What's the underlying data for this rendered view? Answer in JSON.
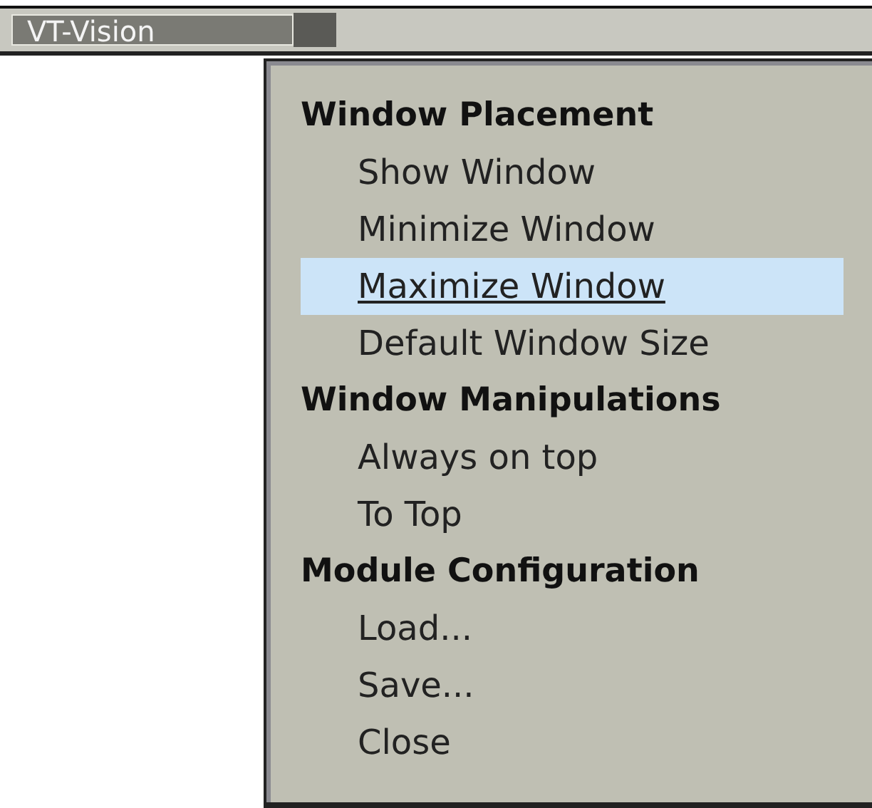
{
  "taskbar": {
    "tab": {
      "label": "VT-Vision"
    }
  },
  "menu": {
    "sections": [
      {
        "heading": "Window Placement",
        "items": [
          {
            "label": "Show Window",
            "selected": false
          },
          {
            "label": "Minimize Window",
            "selected": false
          },
          {
            "label": "Maximize Window",
            "selected": true
          },
          {
            "label": "Default Window Size",
            "selected": false
          }
        ]
      },
      {
        "heading": "Window Manipulations",
        "items": [
          {
            "label": "Always on top",
            "selected": false
          },
          {
            "label": "To Top",
            "selected": false
          }
        ]
      },
      {
        "heading": "Module Configuration",
        "items": [
          {
            "label": "Load...",
            "selected": false
          },
          {
            "label": "Save...",
            "selected": false
          },
          {
            "label": "Close",
            "selected": false
          }
        ]
      }
    ]
  }
}
